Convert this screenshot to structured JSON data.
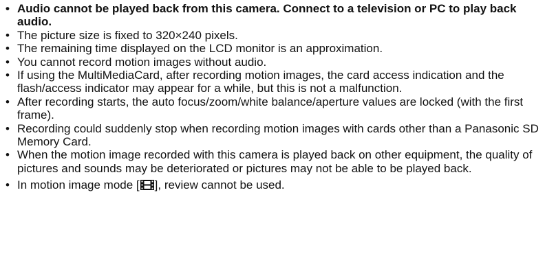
{
  "notes": [
    {
      "text": "Audio cannot be played back from this camera. Connect to a television or PC to play back audio.",
      "bold": true
    },
    {
      "text": "The picture size is fixed to 320×240 pixels."
    },
    {
      "text": "The remaining time displayed on the LCD monitor is an approximation."
    },
    {
      "text": "You cannot record motion images without audio."
    },
    {
      "text": "If using the MultiMediaCard, after recording motion images, the card access indication and the flash/access indicator may appear for a while, but this is not a malfunction."
    },
    {
      "text": "After recording starts, the auto focus/zoom/white balance/aperture values are locked (with the first frame)."
    },
    {
      "text": "Recording could suddenly stop when recording motion images with cards other than a Panasonic SD Memory Card."
    },
    {
      "text": "When the motion image recorded with this camera is played back on other equipment, the quality of pictures and sounds may be deteriorated or pictures may not be able to be played back."
    }
  ],
  "last_note": {
    "before": "In motion image mode [",
    "after": "], review cannot be used.",
    "icon": "motion-image-mode-icon"
  },
  "bullet": "•"
}
